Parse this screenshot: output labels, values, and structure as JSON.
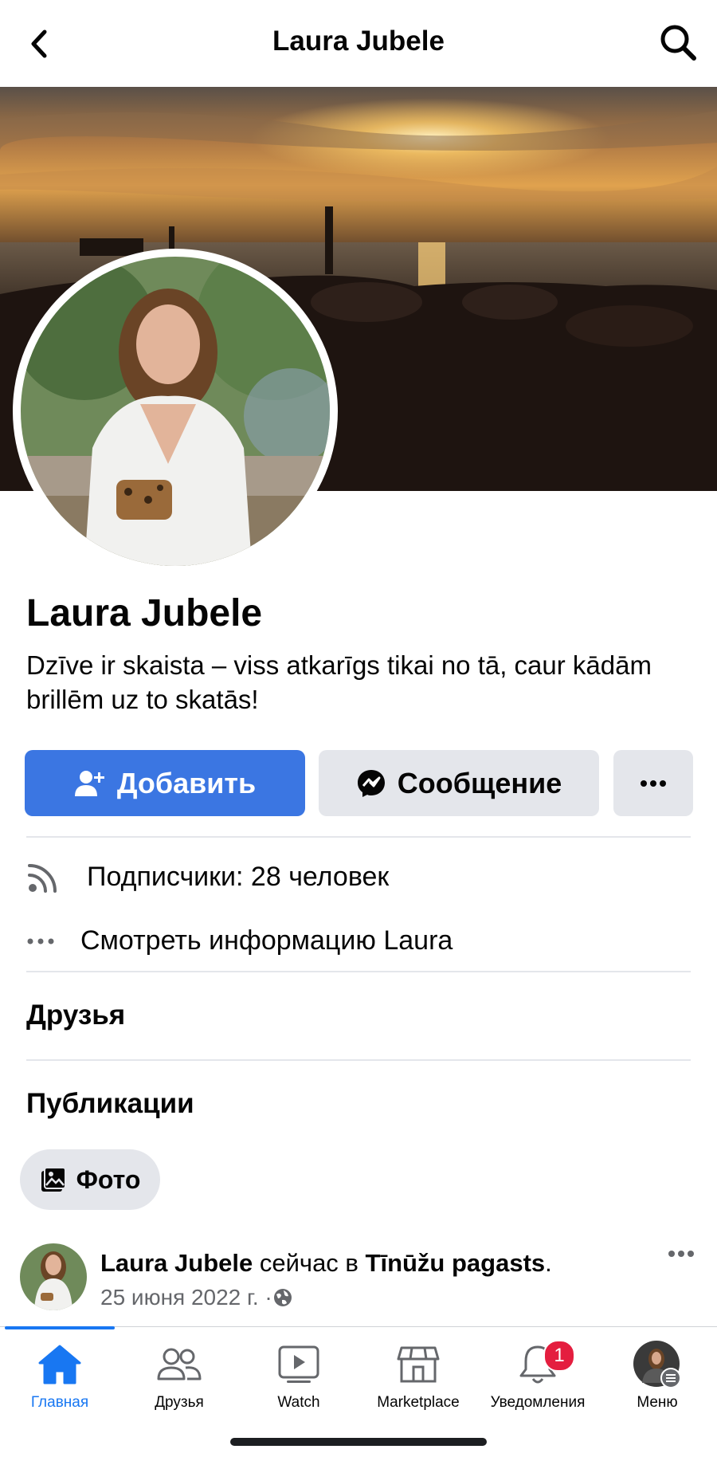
{
  "header": {
    "title": "Laura Jubele"
  },
  "profile": {
    "name": "Laura Jubele",
    "bio": "Dzīve ir skaista – viss atkarīgs tikai no tā, caur kādām brillēm uz to skatās!"
  },
  "actions": {
    "add_label": "Добавить",
    "message_label": "Сообщение"
  },
  "info": {
    "followers": "Подписчики: 28 человек",
    "see_info": "Смотреть информацию Laura"
  },
  "sections": {
    "friends": "Друзья",
    "posts": "Публикации"
  },
  "filters": {
    "photo_chip": "Фото"
  },
  "post": {
    "author": "Laura Jubele",
    "middle": " сейчас в ",
    "place": "Tīnūžu pagasts",
    "end": ".",
    "date": "25 июня 2022 г. · "
  },
  "tabbar": {
    "tabs": [
      {
        "label": "Главная",
        "icon": "home-icon",
        "active": true
      },
      {
        "label": "Друзья",
        "icon": "friends-icon"
      },
      {
        "label": "Watch",
        "icon": "watch-icon"
      },
      {
        "label": "Marketplace",
        "icon": "marketplace-icon"
      },
      {
        "label": "Уведомления",
        "icon": "bell-icon",
        "badge": "1"
      },
      {
        "label": "Меню",
        "icon": "menu-avatar-icon"
      }
    ]
  },
  "colors": {
    "accent": "#1877f2",
    "primary_button": "#3b76e2",
    "badge": "#e41e3f",
    "secondary_button": "#e4e6eb"
  }
}
